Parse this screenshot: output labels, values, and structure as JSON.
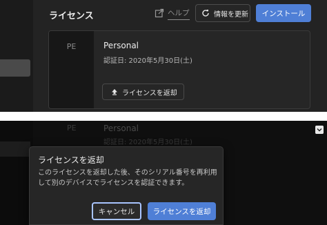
{
  "top": {
    "title": "ライセンス",
    "help_label": "ヘルプ",
    "refresh_label": "情報を更新",
    "install_label": "インストール",
    "license": {
      "badge": "PE",
      "name": "Personal",
      "auth_date": "認証日: 2020年5月30日(土)",
      "return_label": "ライセンスを返却"
    }
  },
  "bottom": {
    "ghost": {
      "badge": "PE",
      "name": "Personal",
      "auth_date": "認証日: 2020年5月30日(土)"
    },
    "dialog": {
      "title": "ライセンスを返却",
      "body": "このライセンスを返却した後、そのシリアル番号を再利用して別のデバイスでライセンスを認証できます。",
      "cancel_label": "キャンセル",
      "confirm_label": "ライセンスを返却"
    }
  },
  "colors": {
    "accent": "#4f7fd6",
    "focus_ring": "#a9c5ff"
  },
  "icons": {
    "external": "external-link-icon",
    "refresh": "refresh-icon",
    "upload": "upload-icon",
    "chevron": "chevron-down-icon"
  }
}
